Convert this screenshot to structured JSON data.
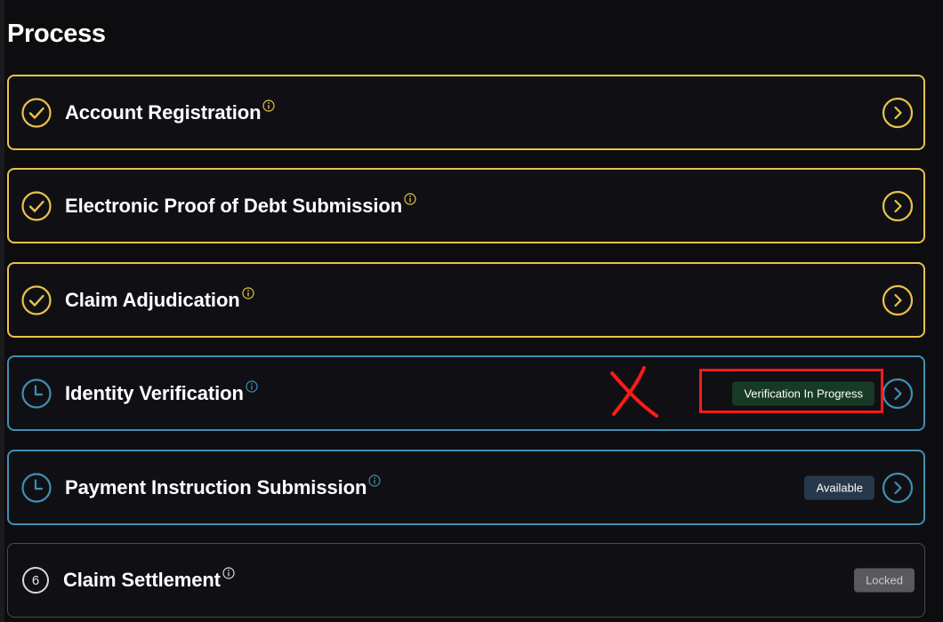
{
  "page": {
    "title": "Process"
  },
  "steps": [
    {
      "label": "Account Registration",
      "status": "completed",
      "status_icon": "check-circle-icon",
      "action_icon": "chevron-right-circle-icon"
    },
    {
      "label": "Electronic Proof of Debt Submission",
      "status": "completed",
      "status_icon": "check-circle-icon",
      "action_icon": "chevron-right-circle-icon"
    },
    {
      "label": "Claim Adjudication",
      "status": "completed",
      "status_icon": "check-circle-icon",
      "action_icon": "chevron-right-circle-icon"
    },
    {
      "label": "Identity Verification",
      "status": "pending",
      "status_icon": "clock-icon",
      "badge": "Verification In Progress",
      "action_icon": "chevron-right-circle-icon"
    },
    {
      "label": "Payment Instruction Submission",
      "status": "pending",
      "status_icon": "clock-icon",
      "badge": "Available",
      "action_icon": "chevron-right-circle-icon"
    },
    {
      "label": "Claim Settlement",
      "status": "locked",
      "number": "6",
      "badge": "Locked"
    }
  ],
  "colors": {
    "background": "#0d0d10",
    "completed_accent": "#e8c34a",
    "pending_accent": "#3f8fb3",
    "locked_border": "#4a4a4f",
    "progress_badge_bg": "#173a26",
    "available_badge_bg": "#26384a",
    "locked_badge_bg": "#5a5a5e",
    "annotation_red": "#ff1a1a"
  },
  "annotation": {
    "mark_icon": "red-x-mark-icon",
    "highlight": "red-highlight-box"
  }
}
